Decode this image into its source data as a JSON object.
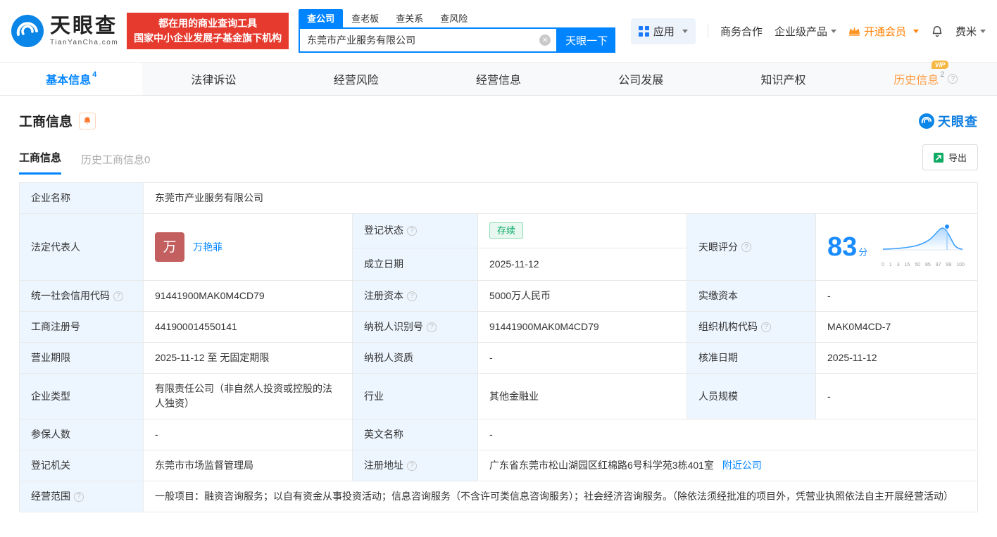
{
  "colors": {
    "brand_blue": "#0084ff",
    "promo_red": "#e63a2e",
    "vip_orange": "#ff8000",
    "status_green": "#00a862"
  },
  "header": {
    "logo_cn": "天眼查",
    "logo_en": "TianYanCha.com",
    "promo_line1": "都在用的商业查询工具",
    "promo_line2": "国家中小企业发展子基金旗下机构",
    "search_tabs": [
      {
        "label": "查公司"
      },
      {
        "label": "查老板"
      },
      {
        "label": "查关系"
      },
      {
        "label": "查风险"
      }
    ],
    "search_value": "东莞市产业服务有限公司",
    "search_button": "天眼一下",
    "nav_app": "应用",
    "nav_business": "商务合作",
    "nav_enterprise": "企业级产品",
    "nav_vip": "开通会员",
    "nav_user": "费米"
  },
  "tabs": [
    {
      "label": "基本信息",
      "count": "4"
    },
    {
      "label": "法律诉讼",
      "count": ""
    },
    {
      "label": "经营风险",
      "count": ""
    },
    {
      "label": "经营信息",
      "count": ""
    },
    {
      "label": "公司发展",
      "count": ""
    },
    {
      "label": "知识产权",
      "count": ""
    },
    {
      "label": "历史信息",
      "count": "2",
      "vip": "VIP"
    }
  ],
  "section": {
    "title": "工商信息",
    "watermark": "天眼查",
    "subtab_current": "工商信息",
    "subtab_history": "历史工商信息0",
    "export_label": "导出"
  },
  "info": {
    "company_name_label": "企业名称",
    "company_name": "东莞市产业服务有限公司",
    "legal_rep_label": "法定代表人",
    "legal_rep_avatar": "万",
    "legal_rep_name": "万艳菲",
    "reg_status_label": "登记状态",
    "reg_status": "存续",
    "establish_label": "成立日期",
    "establish_date": "2025-11-12",
    "score_label": "天眼评分",
    "score_value": "83",
    "score_unit": "分",
    "score_axis": [
      "0",
      "1",
      "3",
      "15",
      "50",
      "85",
      "97",
      "99",
      "100"
    ],
    "credit_code_label": "统一社会信用代码",
    "credit_code": "91441900MAK0M4CD79",
    "reg_capital_label": "注册资本",
    "reg_capital": "5000万人民币",
    "paid_capital_label": "实缴资本",
    "paid_capital": "-",
    "reg_number_label": "工商注册号",
    "reg_number": "441900014550141",
    "taxpayer_id_label": "纳税人识别号",
    "taxpayer_id": "91441900MAK0M4CD79",
    "org_code_label": "组织机构代码",
    "org_code": "MAK0M4CD-7",
    "term_label": "营业期限",
    "term": "2025-11-12 至 无固定期限",
    "taxpayer_quality_label": "纳税人资质",
    "taxpayer_quality": "-",
    "approve_date_label": "核准日期",
    "approve_date": "2025-11-12",
    "company_type_label": "企业类型",
    "company_type": "有限责任公司（非自然人投资或控股的法人独资）",
    "industry_label": "行业",
    "industry": "其他金融业",
    "staff_label": "人员规模",
    "staff": "-",
    "insured_label": "参保人数",
    "insured": "-",
    "english_name_label": "英文名称",
    "english_name": "-",
    "authority_label": "登记机关",
    "authority": "东莞市市场监督管理局",
    "address_label": "注册地址",
    "address": "广东省东莞市松山湖园区红棉路6号科学苑3栋401室",
    "nearby_link": "附近公司",
    "scope_label": "经营范围",
    "scope": "一般项目：融资咨询服务；以自有资金从事投资活动；信息咨询服务（不含许可类信息咨询服务）；社会经济咨询服务。（除依法须经批准的项目外，凭营业执照依法自主开展经营活动）"
  }
}
